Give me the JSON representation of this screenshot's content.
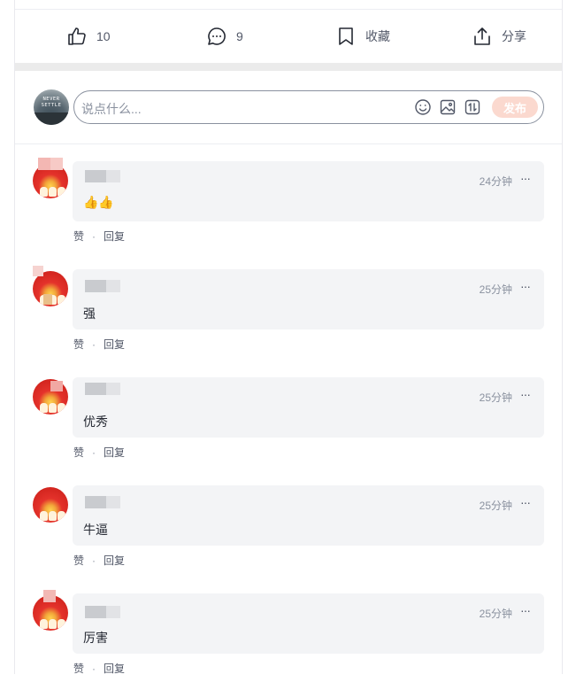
{
  "action_bar": {
    "like_count": "10",
    "comment_count": "9",
    "collect_label": "收藏",
    "share_label": "分享"
  },
  "composer": {
    "avatar_text": "NEVER SETTLE",
    "placeholder": "说点什么...",
    "publish_label": "发布"
  },
  "comments": [
    {
      "time": "24分钟",
      "more": "···",
      "text": "👍👍",
      "like_label": "赞",
      "reply_label": "回复",
      "dot": "·"
    },
    {
      "time": "25分钟",
      "more": "···",
      "text": "强",
      "like_label": "赞",
      "reply_label": "回复",
      "dot": "·"
    },
    {
      "time": "25分钟",
      "more": "···",
      "text": "优秀",
      "like_label": "赞",
      "reply_label": "回复",
      "dot": "·"
    },
    {
      "time": "25分钟",
      "more": "···",
      "text": "牛逼",
      "like_label": "赞",
      "reply_label": "回复",
      "dot": "·"
    },
    {
      "time": "25分钟",
      "more": "···",
      "text": "厉害",
      "like_label": "赞",
      "reply_label": "回复",
      "dot": "·"
    }
  ],
  "colors": {
    "publish_bg": "#fbd9cf",
    "bubble_bg": "#f3f4f6",
    "avatar_red": "#e4322b"
  }
}
